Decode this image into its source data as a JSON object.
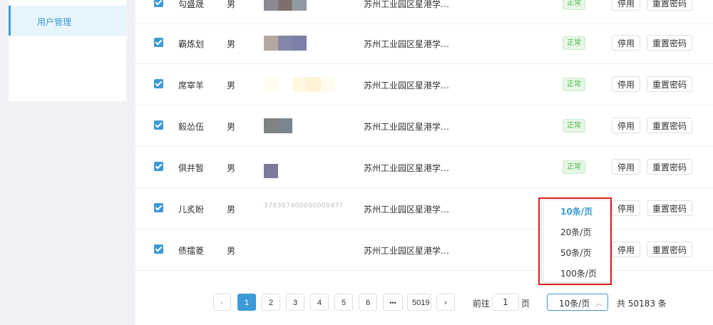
{
  "sidebar": {
    "active_item": "用户管理"
  },
  "table": {
    "rows": [
      {
        "name": "勾盛晟",
        "gender": "男",
        "address": "苏州工业园区星港学…",
        "status": "正常",
        "disable": "停用",
        "reset": "重置密码"
      },
      {
        "name": "霸炼划",
        "gender": "男",
        "address": "苏州工业园区星港学…",
        "status": "正常",
        "disable": "停用",
        "reset": "重置密码"
      },
      {
        "name": "席宰羊",
        "gender": "男",
        "address": "苏州工业园区星港学…",
        "status": "正常",
        "disable": "停用",
        "reset": "重置密码"
      },
      {
        "name": "毅怂伍",
        "gender": "男",
        "address": "苏州工业园区星港学…",
        "status": "正常",
        "disable": "停用",
        "reset": "重置密码"
      },
      {
        "name": "俱井暂",
        "gender": "男",
        "address": "苏州工业园区星港学…",
        "status": "正常",
        "disable": "停用",
        "reset": "重置密码"
      },
      {
        "name": "儿炙盼",
        "gender": "男",
        "id_partial": "37030740000000047?",
        "address": "苏州工业园区星港学…",
        "disable": "停用",
        "reset": "重置密码"
      },
      {
        "name": "债擂菱",
        "gender": "男",
        "address": "苏州工业园区星港学…",
        "disable": "停用",
        "reset": "重置密码"
      }
    ]
  },
  "pagination": {
    "prev": "‹",
    "pages": [
      "1",
      "2",
      "3",
      "4",
      "5",
      "6"
    ],
    "ellipsis": "•••",
    "last_page": "5019",
    "next": "›",
    "goto_label": "前往",
    "goto_value": "1",
    "page_unit": "页",
    "page_size": "10条/页",
    "total": "共 50183 条",
    "size_options": [
      "10条/页",
      "20条/页",
      "50条/页",
      "100条/页"
    ]
  },
  "colors": {
    "accent": "#3d9ad6",
    "status_green": "#4cb84c",
    "highlight": "#e02020"
  },
  "icons": {
    "checkbox": "check-icon",
    "select_arrow": "chevron-up-icon"
  }
}
